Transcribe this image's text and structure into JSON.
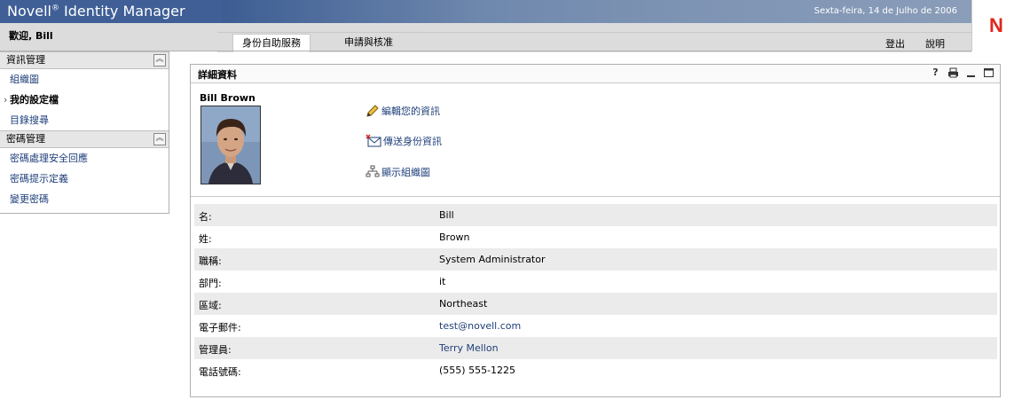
{
  "header": {
    "app_title": "Novell",
    "app_title_mark": "®",
    "app_title_rest": " Identity Manager",
    "date": "Sexta-feira, 14 de Julho de 2006",
    "welcome": "歡迎, Bill",
    "logo_letter": "N"
  },
  "tabs": [
    {
      "label": "身份自助服務",
      "active": true
    },
    {
      "label": "申請與核准",
      "active": false
    }
  ],
  "top_links": {
    "logout": "登出",
    "help": "說明"
  },
  "sidebar": {
    "sections": [
      {
        "title": "資訊管理",
        "items": [
          {
            "label": "組織圖",
            "active": false
          },
          {
            "label": "我的設定檔",
            "active": true
          },
          {
            "label": "目錄搜尋",
            "active": false
          }
        ]
      },
      {
        "title": "密碼管理",
        "items": [
          {
            "label": "密碼處理安全回應",
            "active": false
          },
          {
            "label": "密碼提示定義",
            "active": false
          },
          {
            "label": "變更密碼",
            "active": false
          }
        ]
      }
    ]
  },
  "panel": {
    "title": "詳細資料",
    "icons": [
      "help-icon",
      "print-icon",
      "minimize-icon",
      "maximize-icon"
    ],
    "icon_glyphs": {
      "help": "?"
    },
    "user_name": "Bill Brown",
    "actions": [
      {
        "label": "編輯您的資訊",
        "icon": "pencil-icon"
      },
      {
        "label": "傳送身份資訊",
        "icon": "envelope-icon"
      },
      {
        "label": "顯示組織圖",
        "icon": "org-chart-icon"
      }
    ],
    "rows": [
      {
        "label": "名:",
        "value": "Bill"
      },
      {
        "label": "姓:",
        "value": "Brown"
      },
      {
        "label": "職稱:",
        "value": "System Administrator"
      },
      {
        "label": "部門:",
        "value": "it"
      },
      {
        "label": "區域:",
        "value": "Northeast"
      },
      {
        "label": "電子郵件:",
        "value": "test@novell.com"
      },
      {
        "label": "管理員:",
        "value": "Terry Mellon"
      },
      {
        "label": "電話號碼:",
        "value": "(555) 555-1225"
      }
    ]
  },
  "colors": {
    "brand_blue": "#3f5f96",
    "link_blue": "#1f3f7a",
    "logo_red": "#e1251b"
  }
}
